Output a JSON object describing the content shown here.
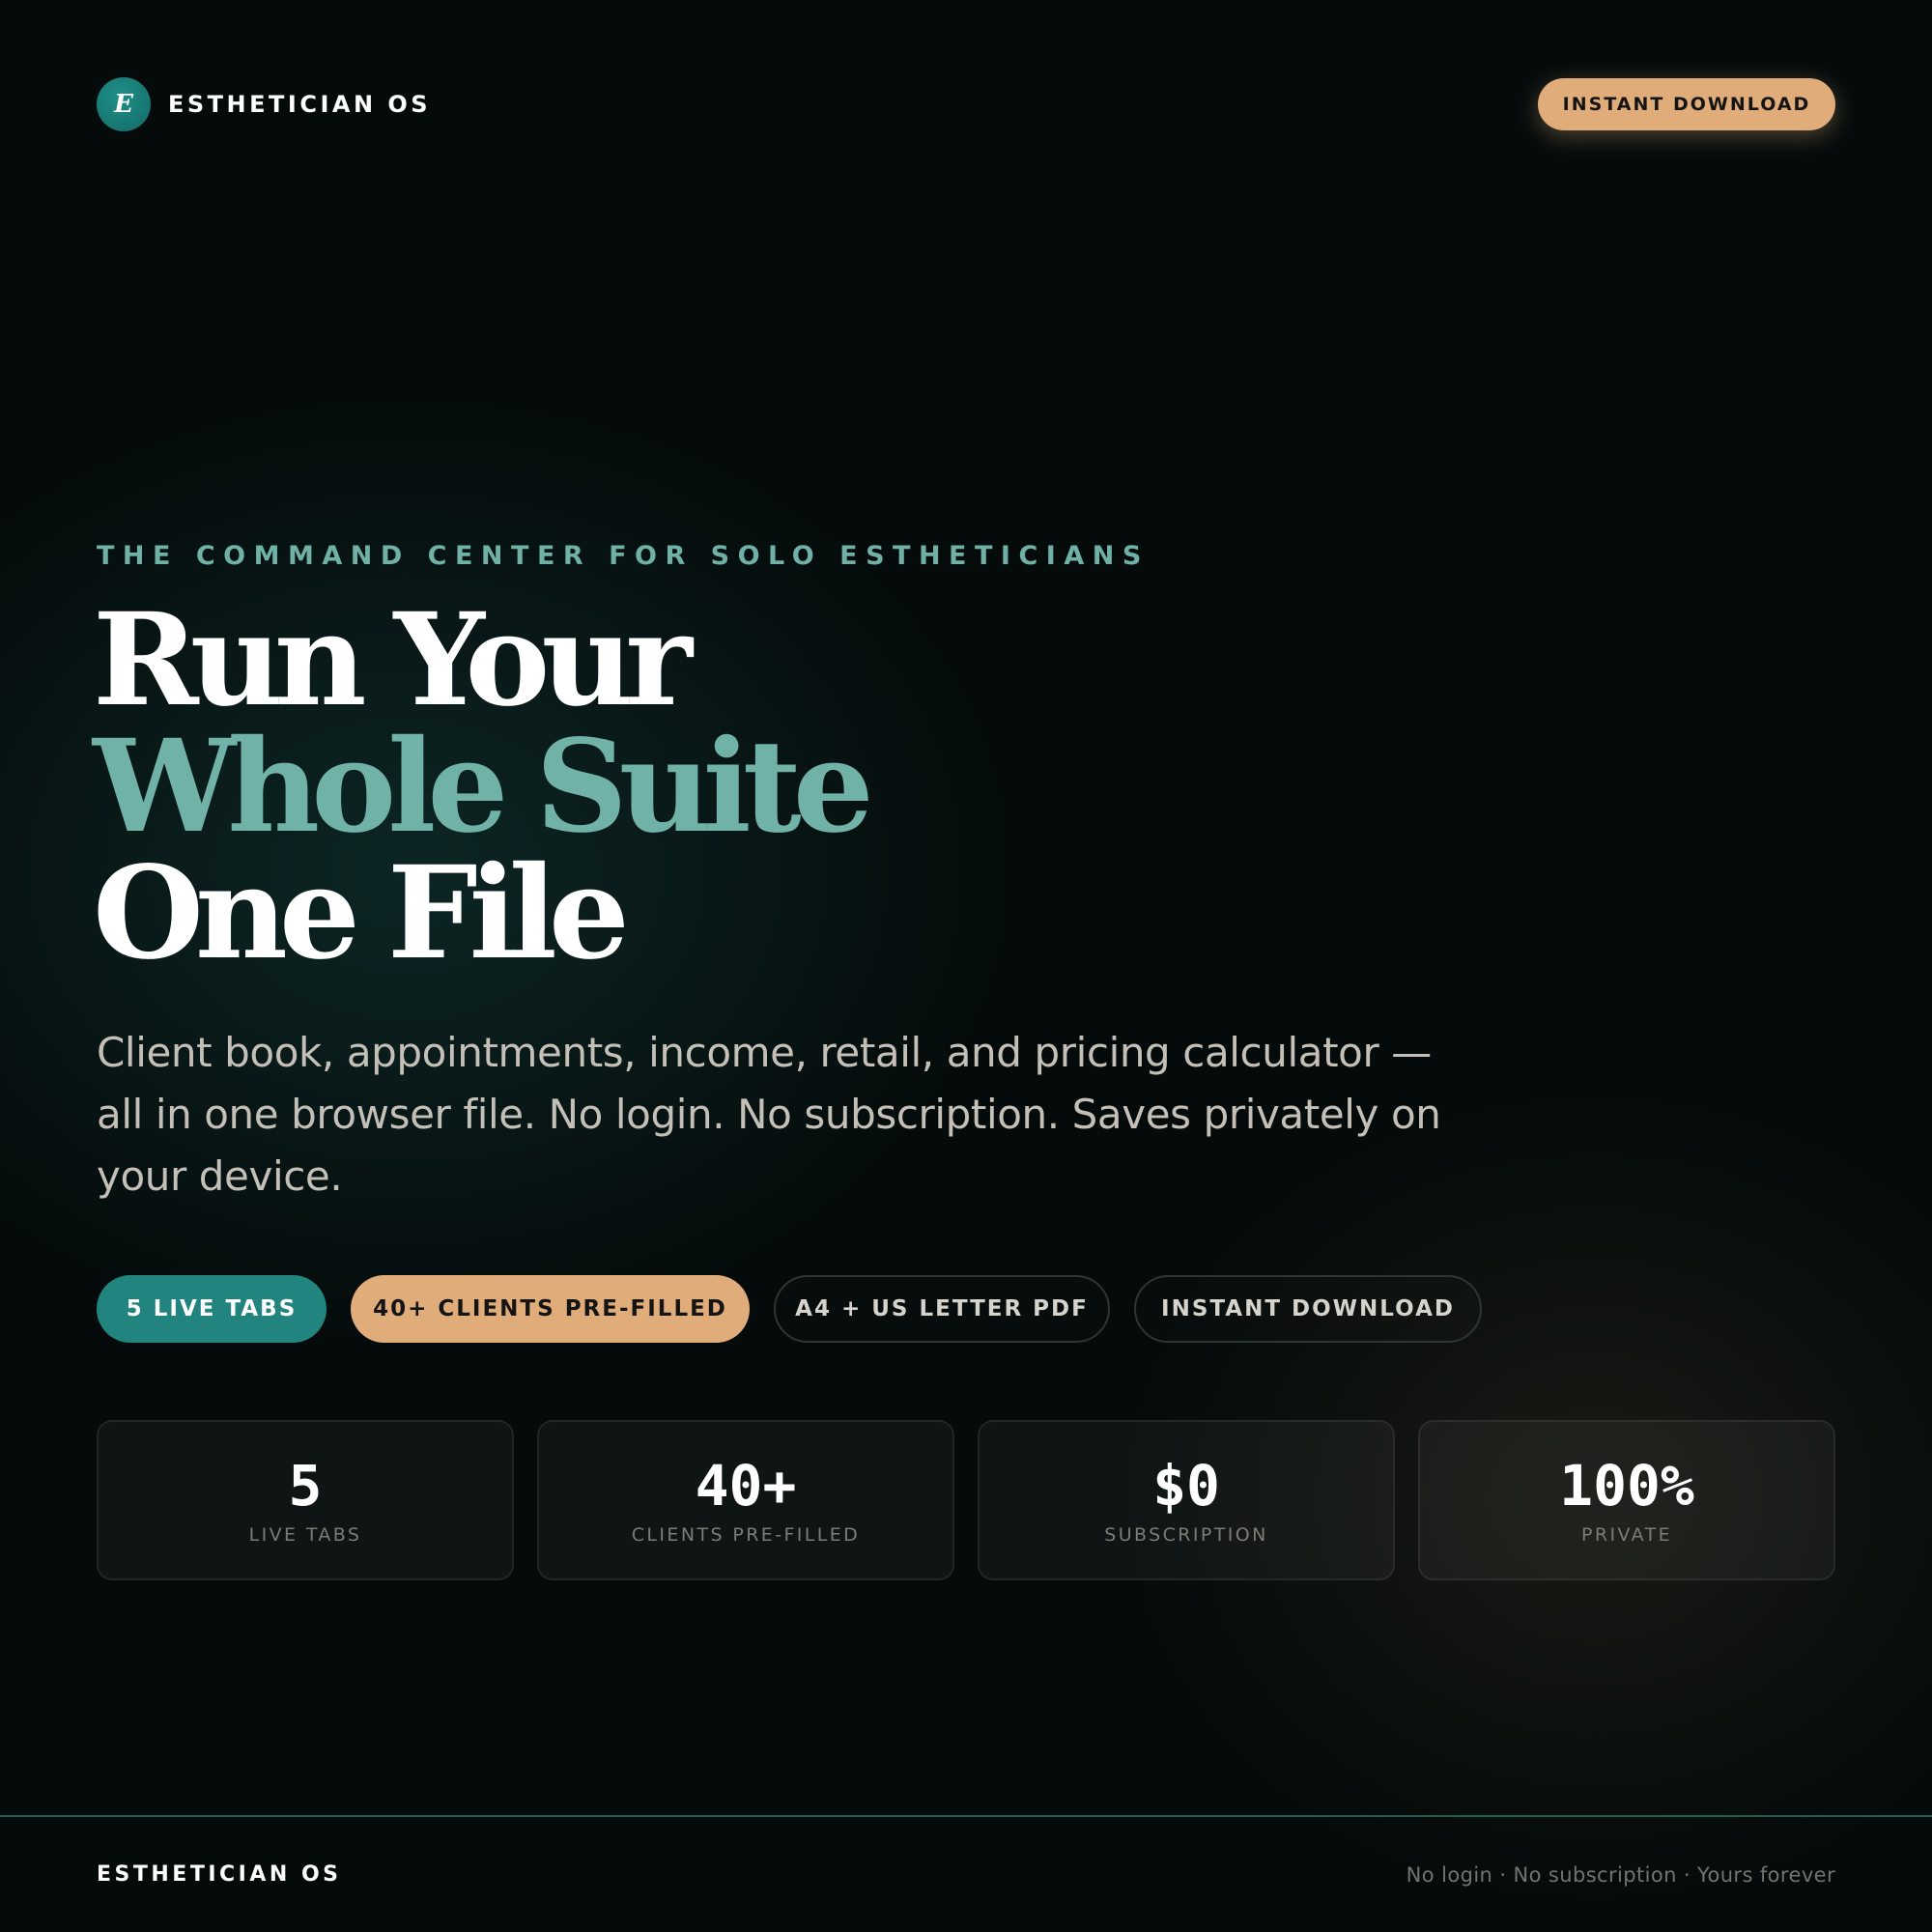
{
  "header": {
    "logo_letter": "E",
    "brand_name": "ESTHETICIAN OS",
    "cta_label": "INSTANT DOWNLOAD"
  },
  "hero": {
    "eyebrow": "THE COMMAND CENTER FOR SOLO ESTHETICIANS",
    "headline": [
      "Run Your",
      "Whole Suite",
      "One File"
    ],
    "lead": "Client book, appointments, income, retail, and pricing calculator — all in one browser file. No login. No subscription. Saves privately on your device."
  },
  "pills": [
    {
      "label": "5 LIVE TABS"
    },
    {
      "label": "40+ CLIENTS PRE-FILLED"
    },
    {
      "label": "A4 + US LETTER PDF"
    },
    {
      "label": "INSTANT DOWNLOAD"
    }
  ],
  "stats": [
    {
      "value": "5",
      "label": "LIVE TABS"
    },
    {
      "value": "40+",
      "label": "CLIENTS PRE-FILLED"
    },
    {
      "value": "$0",
      "label": "SUBSCRIPTION"
    },
    {
      "value": "100%",
      "label": "PRIVATE"
    }
  ],
  "footer": {
    "brand_name": "ESTHETICIAN OS",
    "tagline": "No login · No subscription · Yours forever"
  },
  "colors": {
    "background": "#050b0b",
    "teal_accent": "#22847f",
    "teal_text": "#70b1a8",
    "gold_accent": "#e0ac7a"
  }
}
